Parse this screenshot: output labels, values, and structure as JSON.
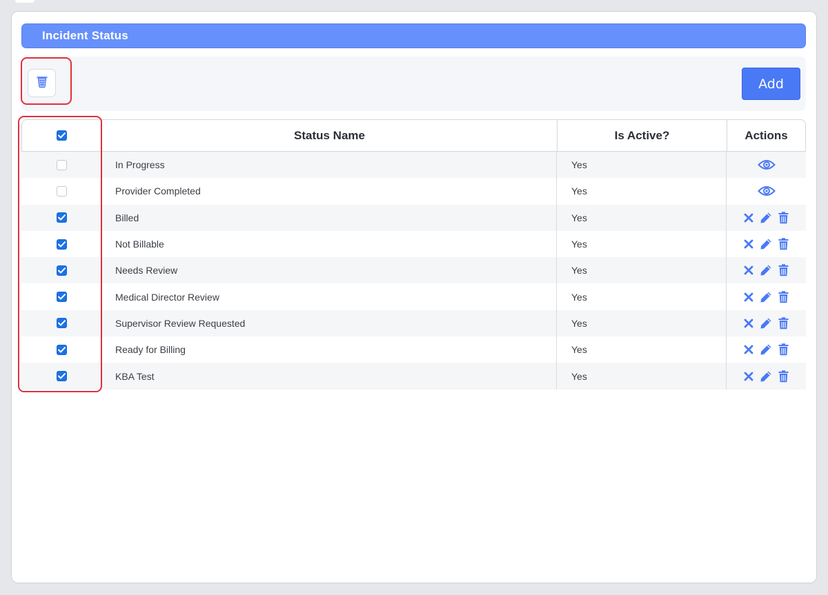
{
  "header": {
    "title": "Incident Status"
  },
  "toolbar": {
    "add_label": "Add",
    "delete_icon": "trash-icon"
  },
  "table": {
    "header_checked": true,
    "columns": [
      "Status Name",
      "Is Active?",
      "Actions"
    ],
    "rows": [
      {
        "name": "In Progress",
        "active": "Yes",
        "checked": false,
        "actions": "view"
      },
      {
        "name": "Provider Completed",
        "active": "Yes",
        "checked": false,
        "actions": "view"
      },
      {
        "name": "Billed",
        "active": "Yes",
        "checked": true,
        "actions": "edit"
      },
      {
        "name": "Not Billable",
        "active": "Yes",
        "checked": true,
        "actions": "edit"
      },
      {
        "name": "Needs Review",
        "active": "Yes",
        "checked": true,
        "actions": "edit"
      },
      {
        "name": "Medical Director Review",
        "active": "Yes",
        "checked": true,
        "actions": "edit"
      },
      {
        "name": "Supervisor Review Requested",
        "active": "Yes",
        "checked": true,
        "actions": "edit"
      },
      {
        "name": "Ready for Billing",
        "active": "Yes",
        "checked": true,
        "actions": "edit"
      },
      {
        "name": "KBA Test",
        "active": "Yes",
        "checked": true,
        "actions": "edit"
      }
    ]
  },
  "colors": {
    "header_bg": "#6690fb",
    "accent": "#4a79f5",
    "checkbox": "#1a73e8",
    "action_icon": "#4a79f5",
    "highlight": "#e0303c"
  }
}
